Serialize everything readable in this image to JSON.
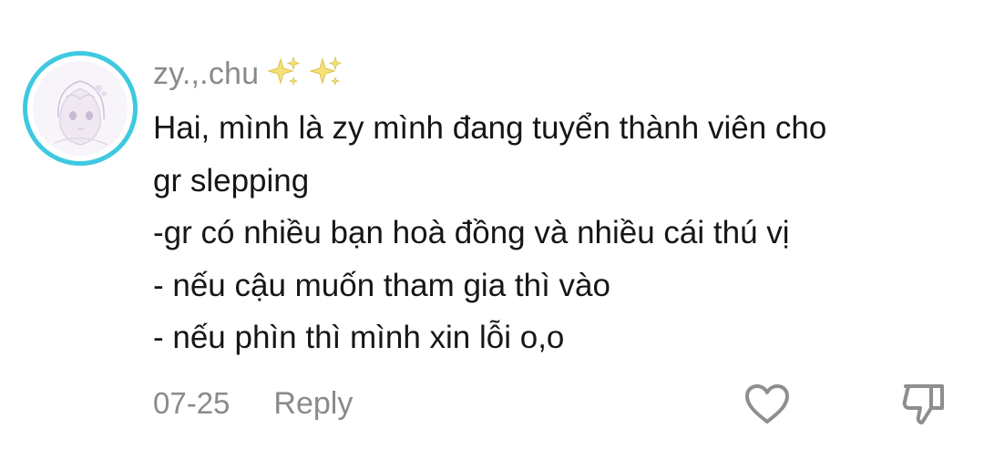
{
  "comment": {
    "username": "zy.,.chu",
    "username_decorations": [
      "sparkle-icon",
      "sparkle-icon"
    ],
    "lines": [
      "Hai, mình là zy mình đang tuyển thành viên cho",
      "gr slepping",
      "-gr có nhiều bạn hoà đồng và nhiều cái thú vị",
      "- nếu cậu muốn tham gia thì vào",
      "- nếu phìn thì mình xin lỗi o,o"
    ],
    "date": "07-25",
    "reply_label": "Reply"
  },
  "actions": {
    "like_icon": "heart-outline-icon",
    "dislike_icon": "thumbs-down-outline-icon"
  },
  "colors": {
    "avatar_ring": "#3fc9e0",
    "meta_text": "#8a8a8a",
    "body_text": "#161616",
    "sparkle": "#f3df6a"
  }
}
